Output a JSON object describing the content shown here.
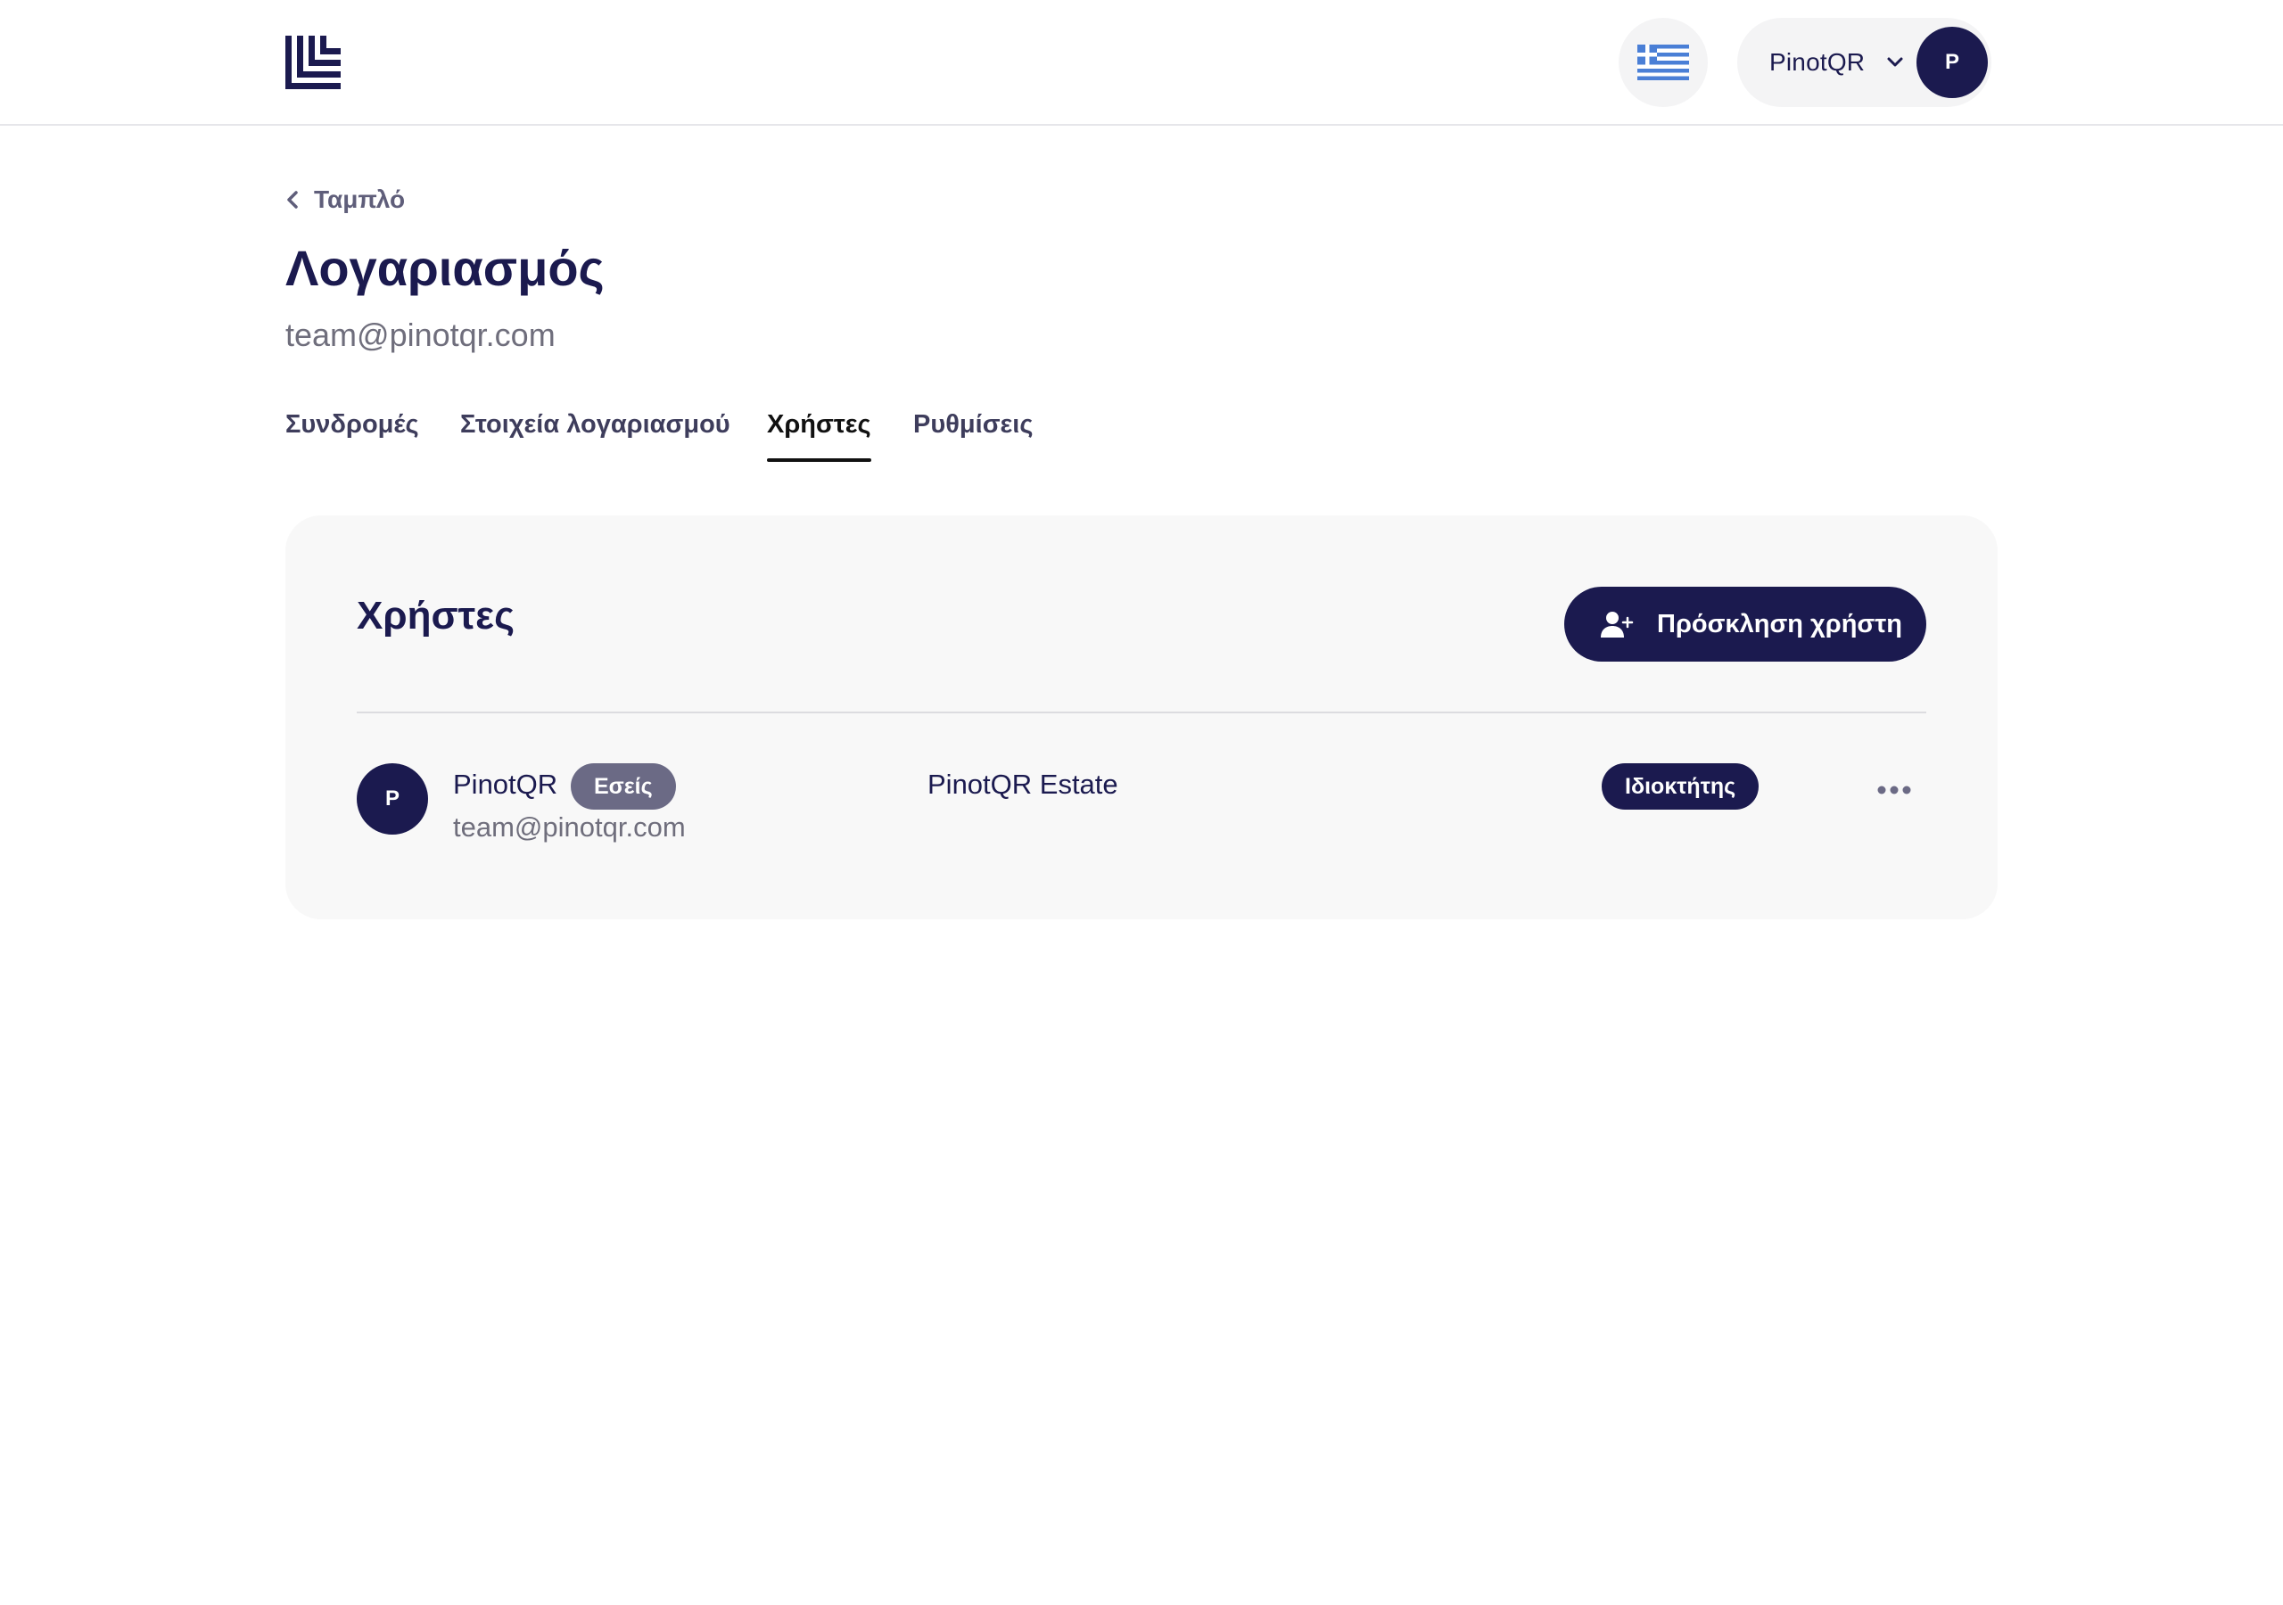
{
  "header": {
    "logo_icon": "brand-logo",
    "language_icon": "greek-flag-icon",
    "user_name": "PinotQR",
    "user_initial": "P"
  },
  "page": {
    "back_label": "Ταμπλό",
    "title": "Λογαριασμός",
    "subtitle": "team@pinotqr.com"
  },
  "tabs": [
    {
      "label": "Συνδρομές",
      "active": false
    },
    {
      "label": "Στοιχεία λογαριασμού",
      "active": false
    },
    {
      "label": "Χρήστες",
      "active": true
    },
    {
      "label": "Ρυθμίσεις",
      "active": false
    }
  ],
  "users_card": {
    "title": "Χρήστες",
    "invite_label": "Πρόσκληση χρήστη",
    "invite_icon": "user-plus-icon",
    "rows": [
      {
        "initial": "P",
        "name": "PinotQR",
        "you_badge": "Εσείς",
        "email": "team@pinotqr.com",
        "organization": "PinotQR Estate",
        "role": "Ιδιοκτήτης",
        "actions_icon": "more-horizontal-icon"
      }
    ]
  },
  "colors": {
    "brand": "#1b1a4f",
    "muted_text": "#6f6e7c",
    "card_bg": "#f8f8f8",
    "badge_muted": "#6b6a85",
    "flag_blue": "#4a7fd6"
  }
}
